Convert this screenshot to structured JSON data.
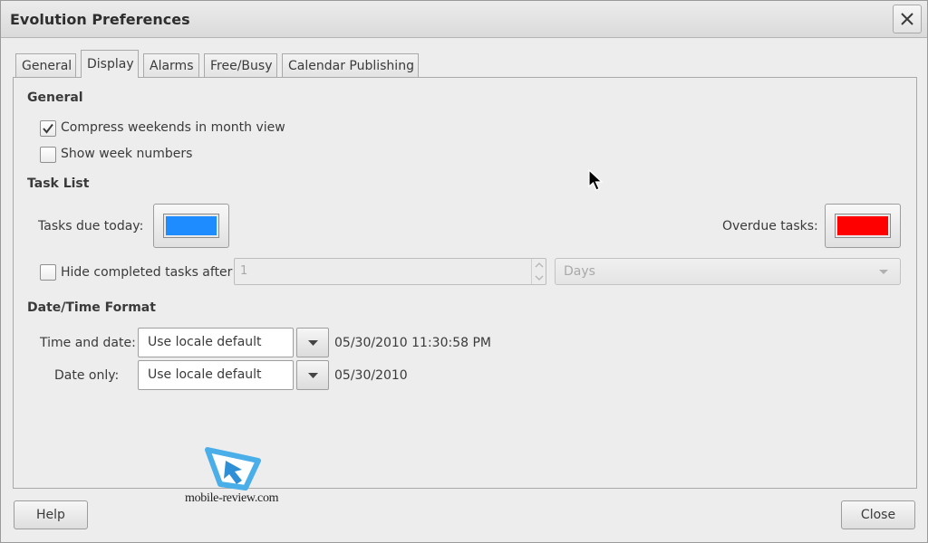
{
  "window": {
    "title": "Evolution Preferences"
  },
  "tabs": [
    {
      "label": "General",
      "active": false
    },
    {
      "label": "Display",
      "active": true
    },
    {
      "label": "Alarms",
      "active": false
    },
    {
      "label": "Free/Busy",
      "active": false
    },
    {
      "label": "Calendar Publishing",
      "active": false
    }
  ],
  "general": {
    "heading": "General",
    "compress_weekends": {
      "label": "Compress weekends in month view",
      "checked": true
    },
    "show_week_numbers": {
      "label": "Show week numbers",
      "checked": false
    }
  },
  "task_list": {
    "heading": "Task List",
    "tasks_due_today": {
      "label": "Tasks due today:",
      "color": "#1e8cff"
    },
    "overdue_tasks": {
      "label": "Overdue tasks:",
      "color": "#ff0000"
    },
    "hide_completed": {
      "label": "Hide completed tasks after",
      "checked": false,
      "value": "1",
      "unit": "Days"
    }
  },
  "datetime_format": {
    "heading": "Date/Time Format",
    "time_and_date": {
      "label": "Time and date:",
      "value": "Use locale default",
      "preview": "05/30/2010 11:30:58 PM"
    },
    "date_only": {
      "label": "Date only:",
      "value": "Use locale default",
      "preview": "05/30/2010"
    }
  },
  "buttons": {
    "help": "Help",
    "close": "Close"
  },
  "watermark": {
    "text": "mobile-review.com"
  }
}
